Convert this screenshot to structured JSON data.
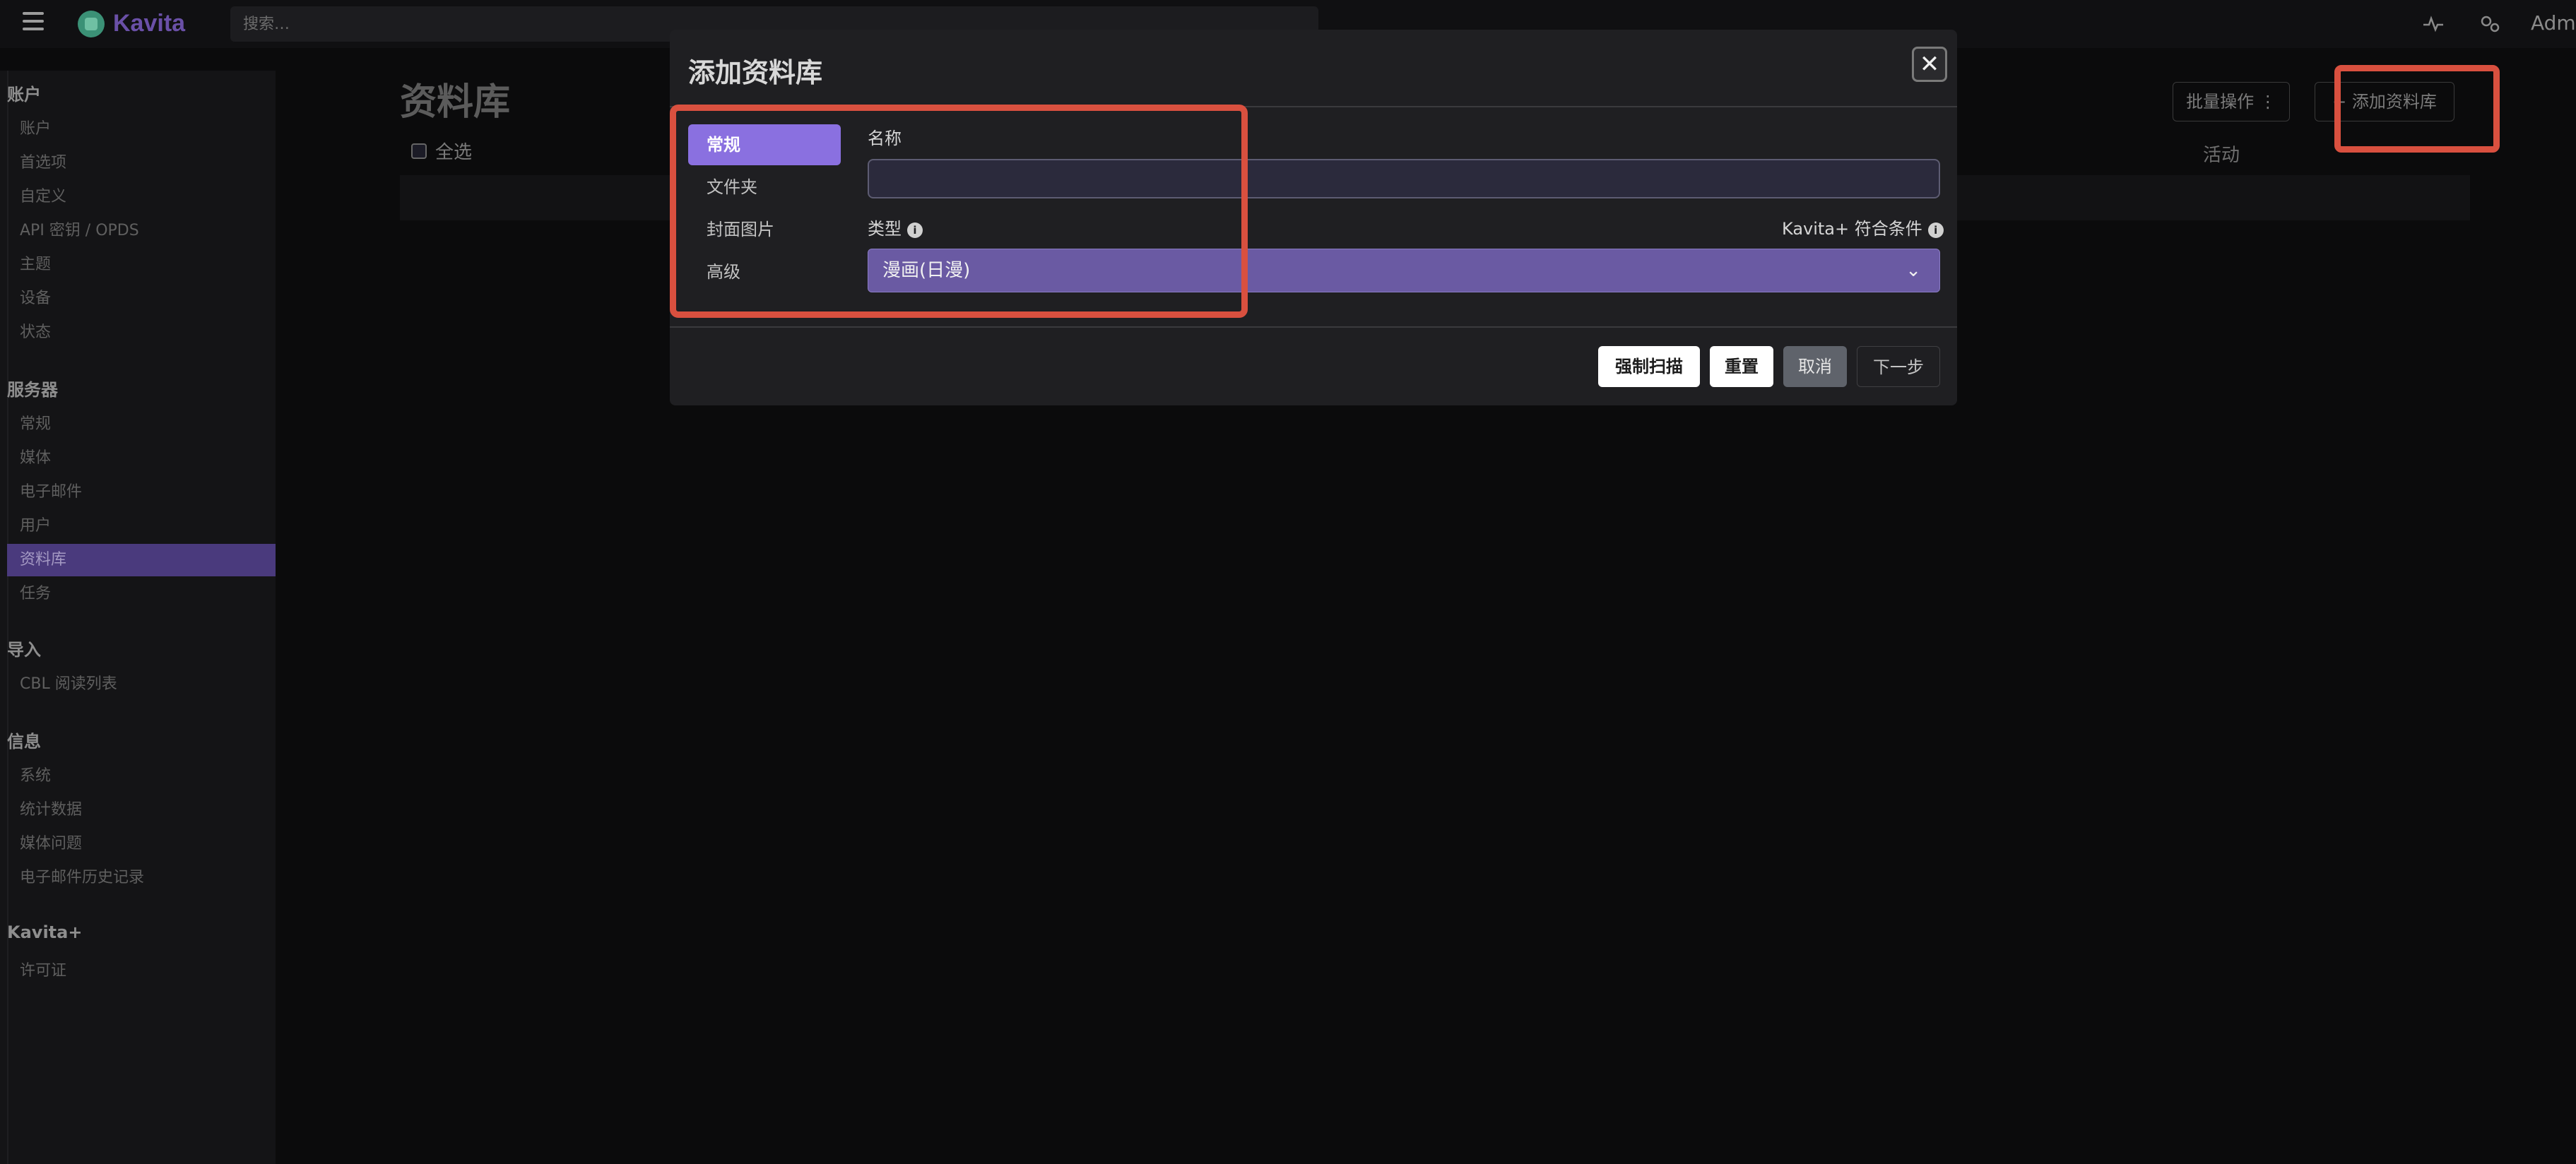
{
  "navbar": {
    "app_name": "Kavita",
    "search_placeholder": "搜索…",
    "user_label": "Admin"
  },
  "sidebar": {
    "sections": [
      {
        "header": "账户",
        "items": [
          "账户",
          "首选项",
          "自定义",
          "API 密钥 / OPDS",
          "主题",
          "设备",
          "状态"
        ]
      },
      {
        "header": "服务器",
        "items": [
          "常规",
          "媒体",
          "电子邮件",
          "用户",
          "资料库",
          "任务"
        ]
      },
      {
        "header": "导入",
        "items": [
          "CBL 阅读列表"
        ]
      },
      {
        "header": "信息",
        "items": [
          "系统",
          "统计数据",
          "媒体问题",
          "电子邮件历史记录"
        ]
      },
      {
        "header": "Kavita+",
        "items": [
          "许可证"
        ]
      }
    ],
    "active_item": "资料库"
  },
  "page": {
    "title": "资料库",
    "select_all_label": "全选",
    "activity_column": "活动",
    "bulk_actions_label": "批量操作",
    "add_library_label": "添加资料库"
  },
  "modal": {
    "title": "添加资料库",
    "tabs": [
      "常规",
      "文件夹",
      "封面图片",
      "高级"
    ],
    "active_tab": "常规",
    "name_label": "名称",
    "name_value": "",
    "type_label": "类型",
    "kavita_plus_label": "Kavita+ 符合条件",
    "type_value": "漫画(日漫)",
    "buttons": {
      "force_scan": "强制扫描",
      "reset": "重置",
      "cancel": "取消",
      "next": "下一步"
    }
  },
  "colors": {
    "accent": "#8a70e0",
    "highlight": "#d9503f",
    "sidebar_active": "#4a3a7d",
    "type_select": "#6a5aa3"
  }
}
